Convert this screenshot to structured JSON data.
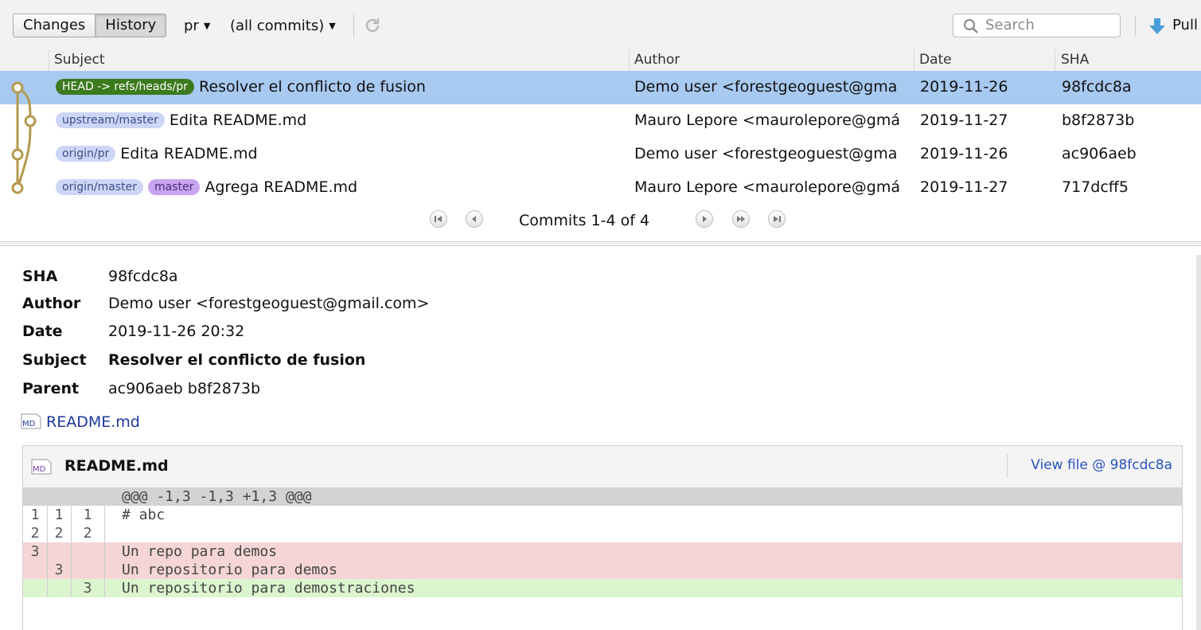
{
  "toolbar": {
    "tabs": [
      "Changes",
      "History"
    ],
    "branch": "pr",
    "commit_filter": "(all commits)",
    "search_placeholder": "Search",
    "pull_label": "Pull"
  },
  "commits_table": {
    "columns": [
      "Subject",
      "Author",
      "Date",
      "SHA"
    ],
    "rows": [
      {
        "refs": [
          "HEAD -> refs/heads/pr"
        ],
        "subject": "Resolver el conflicto de fusion",
        "author": "Demo user <forestgeoguest@gma",
        "date": "2019-11-26",
        "sha": "98fcdc8a",
        "selected": true
      },
      {
        "refs": [
          "upstream/master"
        ],
        "subject": "Edita README.md",
        "author": "Mauro Lepore <maurolepore@gmá",
        "date": "2019-11-27",
        "sha": "b8f2873b",
        "selected": false
      },
      {
        "refs": [
          "origin/pr"
        ],
        "subject": "Edita README.md",
        "author": "Demo user <forestgeoguest@gma",
        "date": "2019-11-26",
        "sha": "ac906aeb",
        "selected": false
      },
      {
        "refs": [
          "origin/master",
          "master"
        ],
        "subject": "Agrega README.md",
        "author": "Mauro Lepore <maurolepore@gmá",
        "date": "2019-11-27",
        "sha": "717dcff5",
        "selected": false
      }
    ]
  },
  "pager": {
    "label": "Commits 1-4 of 4"
  },
  "detail": {
    "labels": {
      "sha": "SHA",
      "author": "Author",
      "date": "Date",
      "subject": "Subject",
      "parent": "Parent"
    },
    "sha": "98fcdc8a",
    "author": "Demo user <forestgeoguest@gmail.com>",
    "date": "2019-11-26 20:32",
    "subject": "Resolver el conflicto de fusion",
    "parent": "ac906aeb b8f2873b",
    "file_link": "README.md",
    "file_icon_text": "MD"
  },
  "diff": {
    "filename": "README.md",
    "view_link": "View file @ 98fcdc8a",
    "lines": [
      {
        "type": "hunk",
        "n1": "",
        "n2": "",
        "n3": "",
        "text": "@@@ -1,3 -1,3 +1,3 @@@"
      },
      {
        "type": "ctx",
        "n1": "1",
        "n2": "1",
        "n3": "1",
        "text": "# abc"
      },
      {
        "type": "ctx",
        "n1": "2",
        "n2": "2",
        "n3": "2",
        "text": ""
      },
      {
        "type": "del",
        "n1": "3",
        "n2": "",
        "n3": "",
        "text": "Un repo para demos"
      },
      {
        "type": "del",
        "n1": "",
        "n2": "3",
        "n3": "",
        "text": "Un repositorio para demos"
      },
      {
        "type": "add",
        "n1": "",
        "n2": "",
        "n3": "3",
        "text": "Un repositorio para demostraciones"
      }
    ]
  },
  "colors": {
    "selected_row": "#a8c9f0",
    "head_badge": "#3c7a1e",
    "ref_badge": "#cdd6f6",
    "master_badge": "#c8a5f0",
    "graph_line": "#b49a4e",
    "deleted_bg": "#f5d5d5",
    "added_bg": "#dbf5cf",
    "link": "#1c3a9c"
  }
}
